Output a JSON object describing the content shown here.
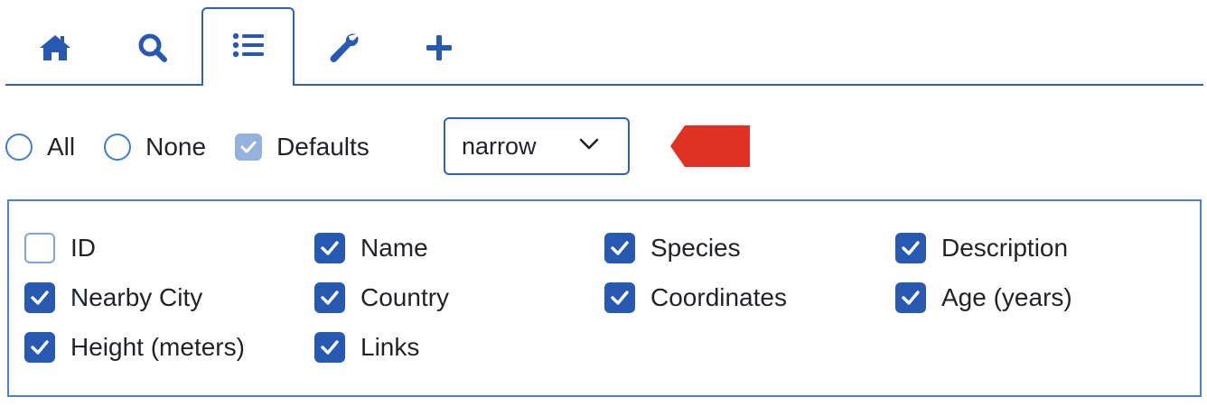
{
  "tabs": [
    {
      "icon": "home-icon",
      "active": false
    },
    {
      "icon": "search-icon",
      "active": false
    },
    {
      "icon": "list-icon",
      "active": true
    },
    {
      "icon": "wrench-icon",
      "active": false
    },
    {
      "icon": "plus-icon",
      "active": false
    }
  ],
  "selector": {
    "all_label": "All",
    "none_label": "None",
    "defaults_label": "Defaults",
    "defaults_checked": true,
    "width_select_value": "narrow"
  },
  "columns": [
    {
      "label": "ID",
      "checked": false
    },
    {
      "label": "Name",
      "checked": true
    },
    {
      "label": "Species",
      "checked": true
    },
    {
      "label": "Description",
      "checked": true
    },
    {
      "label": "Nearby City",
      "checked": true
    },
    {
      "label": "Country",
      "checked": true
    },
    {
      "label": "Coordinates",
      "checked": true
    },
    {
      "label": "Age (years)",
      "checked": true
    },
    {
      "label": "Height (meters)",
      "checked": true
    },
    {
      "label": "Links",
      "checked": true
    }
  ],
  "colors": {
    "accent": "#2759b3",
    "border": "#2d62b8",
    "defaults_fill": "#95b2df",
    "arrow": "#e03224"
  }
}
